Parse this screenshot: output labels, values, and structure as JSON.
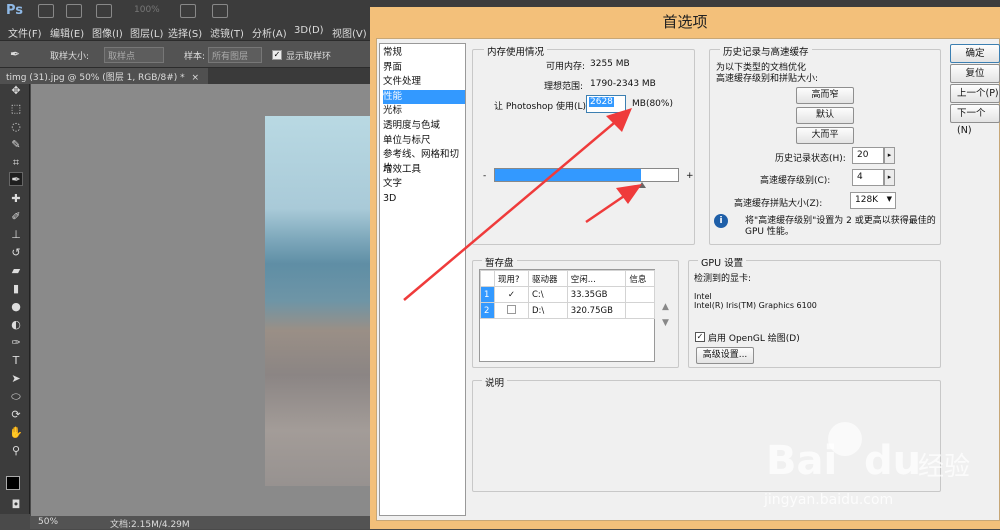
{
  "app": {
    "logo": "Ps",
    "zoom": "100%"
  },
  "menu": [
    "文件(F)",
    "编辑(E)",
    "图像(I)",
    "图层(L)",
    "选择(S)",
    "滤镜(T)",
    "分析(A)",
    "3D(D)",
    "视图(V)"
  ],
  "options": {
    "sample_size_label": "取样大小:",
    "sample_size_value": "取样点",
    "sample_label": "样本:",
    "sample_value": "所有图层",
    "show_ring_label": "显示取样环"
  },
  "doc_tab": {
    "title": "timg (31).jpg @ 50% (图层 1, RGB/8#) *",
    "close": "×"
  },
  "status": {
    "zoom": "50%",
    "doc": "文档:2.15M/4.29M"
  },
  "dialog": {
    "title": "首选项",
    "categories": [
      "常规",
      "界面",
      "文件处理",
      "性能",
      "光标",
      "透明度与色域",
      "单位与标尺",
      "参考线、网格和切片",
      "增效工具",
      "文字",
      "3D"
    ],
    "selected_category": "性能",
    "memory": {
      "legend": "内存使用情况",
      "available_label": "可用内存:",
      "available_value": "3255 MB",
      "ideal_label": "理想范围:",
      "ideal_value": "1790-2343 MB",
      "use_label": "让 Photoshop 使用(L):",
      "use_value": "2628",
      "use_suffix": "MB(80%)",
      "slider_min": "-",
      "slider_max": "+",
      "slider_fraction": 0.8
    },
    "history": {
      "legend": "历史记录与高速缓存",
      "desc1": "为以下类型的文档优化",
      "desc2": "高速缓存级别和拼贴大小:",
      "btn_tall": "高而窄",
      "btn_default": "默认",
      "btn_big": "大而平",
      "states_label": "历史记录状态(H):",
      "states_value": "20",
      "cache_label": "高速缓存级别(C):",
      "cache_value": "4",
      "tile_label": "高速缓存拼贴大小(Z):",
      "tile_value": "128K",
      "note1": "将\"高速缓存级别\"设置为 2 或更高以获得最佳的",
      "note2": "GPU 性能。"
    },
    "scratch": {
      "legend": "暂存盘",
      "headers": [
        "现用?",
        "驱动器",
        "空闲...",
        "信息"
      ],
      "rows": [
        {
          "num": "1",
          "active": "✓",
          "drive": "C:\\",
          "free": "33.35GB",
          "info": ""
        },
        {
          "num": "2",
          "active": "",
          "drive": "D:\\",
          "free": "320.75GB",
          "info": ""
        }
      ]
    },
    "gpu": {
      "legend": "GPU 设置",
      "detected_label": "检测到的显卡:",
      "vendor": "Intel",
      "model": "Intel(R) Iris(TM) Graphics 6100",
      "opengl_label": "启用 OpenGL 绘图(D)",
      "advanced_btn": "高级设置..."
    },
    "description": {
      "legend": "说明"
    },
    "buttons": {
      "ok": "确定",
      "reset": "复位",
      "prev": "上一个(P)",
      "next": "下一个(N)"
    }
  },
  "watermark": {
    "brand": "Bai",
    "brand2": "du",
    "cn": "经验",
    "url": "jingyan.baidu.com"
  },
  "colors": {
    "accent": "#3399ff",
    "arrow": "#ef3b3b",
    "dialog_frame": "#f3c07a"
  }
}
